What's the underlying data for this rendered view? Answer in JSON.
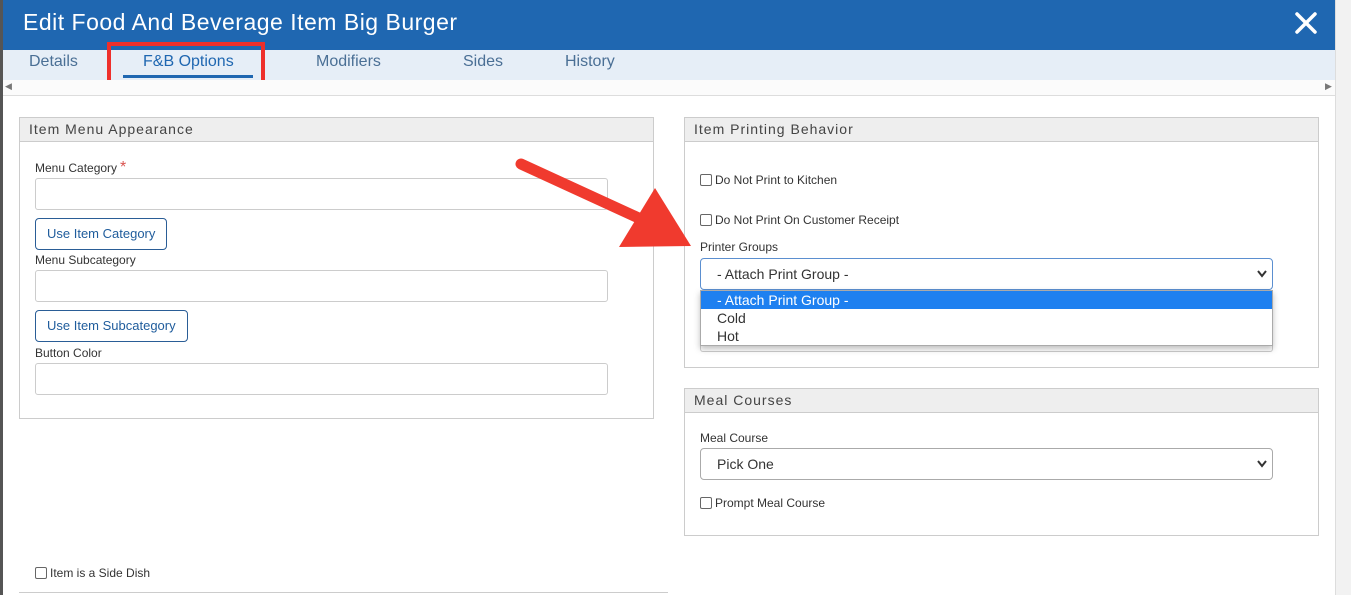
{
  "window": {
    "title": "Edit Food And Beverage Item Big Burger",
    "close_icon": "close-icon"
  },
  "tabs": [
    {
      "label": "Details"
    },
    {
      "label": "F&B Options",
      "active": true
    },
    {
      "label": "Modifiers"
    },
    {
      "label": "Sides"
    },
    {
      "label": "History"
    }
  ],
  "menu_appearance": {
    "heading": "Item Menu Appearance",
    "menu_category_label": "Menu Category",
    "required_mark": "*",
    "menu_category_value": "",
    "use_item_category_label": "Use Item Category",
    "menu_subcategory_label": "Menu Subcategory",
    "menu_subcategory_value": "",
    "use_item_subcategory_label": "Use Item Subcategory",
    "button_color_label": "Button Color",
    "button_color_value": ""
  },
  "printing": {
    "heading": "Item Printing Behavior",
    "no_print_kitchen_label": "Do Not Print to Kitchen",
    "no_print_kitchen_checked": false,
    "no_print_receipt_label": "Do Not Print On Customer Receipt",
    "no_print_receipt_checked": false,
    "printer_groups_label": "Printer Groups",
    "printer_groups_selected": "- Attach Print Group -",
    "printer_groups_options": [
      "- Attach Print Group -",
      "Cold",
      "Hot"
    ]
  },
  "meal_courses": {
    "heading": "Meal Courses",
    "meal_course_label": "Meal Course",
    "meal_course_selected": "Pick One",
    "prompt_meal_course_label": "Prompt Meal Course",
    "prompt_meal_course_checked": false
  },
  "side_dish": {
    "label": "Item is a Side Dish",
    "checked": false
  },
  "colors": {
    "title_bar": "#1f67b1",
    "highlight": "#ee2f2b",
    "option_selected": "#1e80f0"
  }
}
